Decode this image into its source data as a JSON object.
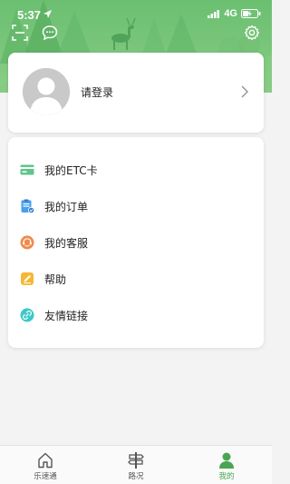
{
  "status_bar": {
    "time": "5:37",
    "network": "4G"
  },
  "colors": {
    "brand_green": "#6bbf71",
    "active_tab": "#4aa552"
  },
  "header": {
    "icons": [
      "scan-icon",
      "chat-bubble-icon",
      "settings-gear-icon"
    ]
  },
  "profile": {
    "login_prompt": "请登录"
  },
  "menu": {
    "items": [
      {
        "label": "我的ETC卡",
        "icon": "card-icon"
      },
      {
        "label": "我的订单",
        "icon": "order-clipboard-icon"
      },
      {
        "label": "我的客服",
        "icon": "customer-service-icon"
      },
      {
        "label": "帮助",
        "icon": "help-pencil-icon"
      },
      {
        "label": "友情链接",
        "icon": "link-icon"
      }
    ]
  },
  "tabbar": {
    "tabs": [
      {
        "label": "乐速通",
        "icon": "home-icon",
        "active": false
      },
      {
        "label": "路况",
        "icon": "signpost-icon",
        "active": false
      },
      {
        "label": "我的",
        "icon": "user-icon",
        "active": true
      }
    ]
  }
}
